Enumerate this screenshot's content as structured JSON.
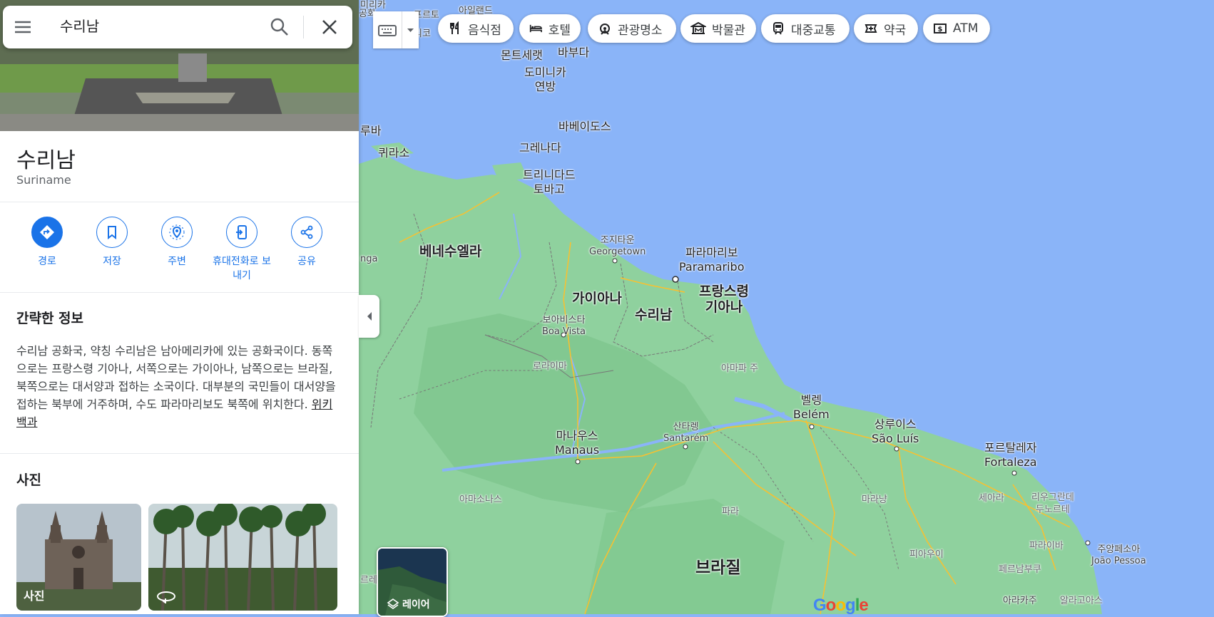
{
  "search": {
    "query": "수리남"
  },
  "place": {
    "name": "수리남",
    "native_name": "Suriname"
  },
  "actions": [
    {
      "label": "경로"
    },
    {
      "label": "저장"
    },
    {
      "label": "주변"
    },
    {
      "label": "휴대전화로 보내기"
    },
    {
      "label": "공유"
    }
  ],
  "overview": {
    "title": "간략한 정보",
    "text": "수리남 공화국, 약칭 수리남은 남아메리카에 있는 공화국이다. 동쪽으로는 프랑스령 기아나, 서쪽으로는 가이아나, 남쪽으로는 브라질, 북쪽으로는 대서양과 접하는 소국이다. 대부분의 국민들이 대서양을 접하는 북부에 거주하며, 수도 파라마리보도 북쪽에 위치한다.",
    "source": "위키백과"
  },
  "photos": {
    "title": "사진",
    "items": [
      {
        "label": "사진"
      },
      {
        "label": ""
      }
    ]
  },
  "chips": [
    {
      "label": "음식점",
      "icon": "restaurant-icon"
    },
    {
      "label": "호텔",
      "icon": "hotel-icon"
    },
    {
      "label": "관광명소",
      "icon": "attractions-icon"
    },
    {
      "label": "박물관",
      "icon": "museum-icon"
    },
    {
      "label": "대중교통",
      "icon": "transit-icon"
    },
    {
      "label": "약국",
      "icon": "pharmacy-icon"
    },
    {
      "label": "ATM",
      "icon": "atm-icon"
    }
  ],
  "layers": {
    "label": "레이어"
  },
  "map_labels": {
    "venezuela": "베네수엘라",
    "guyana": "가이아나",
    "suriname": "수리남",
    "french_guiana_1": "프랑스령",
    "french_guiana_2": "기아나",
    "brazil": "브라질",
    "paramaribo_ko": "파라마리보",
    "paramaribo_en": "Paramaribo",
    "georgetown_ko": "조지타운",
    "georgetown_en": "Georgetown",
    "boavista_ko": "보아비스타",
    "boavista_en": "Boa Vista",
    "manaus_ko": "마나우스",
    "manaus_en": "Manaus",
    "santarem_ko": "산타렝",
    "santarem_en": "Santarém",
    "belem_ko": "벨렝",
    "belem_en": "Belém",
    "saoluis_ko": "상루이스",
    "saoluis_en": "São Luís",
    "fortaleza_ko": "포르탈레자",
    "fortaleza_en": "Fortaleza",
    "joaopessoa_ko": "주앙페소아",
    "joaopessoa_en": "João Pessoa",
    "trinidad_1": "트리니다드",
    "trinidad_2": "토바고",
    "grenada": "그레나다",
    "barbados": "바베이도스",
    "dominica_1": "도미니카",
    "dominica_2": "연방",
    "montserrat": "몬트세랫",
    "barbuda": "바부다",
    "curacao": "퀴라소",
    "aruba": "루바",
    "roraima": "로라이마",
    "amapa": "아마파 주",
    "amazonas": "아마소나스",
    "para": "파라",
    "maranhao": "마라냥",
    "ceara": "세아라",
    "rgn_1": "리우그란데",
    "rgn_2": "두노르테",
    "piaui": "피아우이",
    "paraiba": "파라이바",
    "pernambuco": "페르남부쿠",
    "alagoas": "알라고아스",
    "aracaju": "아라카주",
    "aracaju_en": "Aracaju",
    "anga": "nga",
    "top_1": "아일랜드",
    "top_2": "공화",
    "top_3": "리코",
    "top_4": "미리카",
    "top_5": "프르토",
    "left_edge": "르레"
  },
  "colors": {
    "ocean": "#8ab4f8",
    "land": "#8fd19e",
    "forest": "#7cc48b",
    "road": "#fbc02d",
    "accent": "#1a73e8"
  }
}
